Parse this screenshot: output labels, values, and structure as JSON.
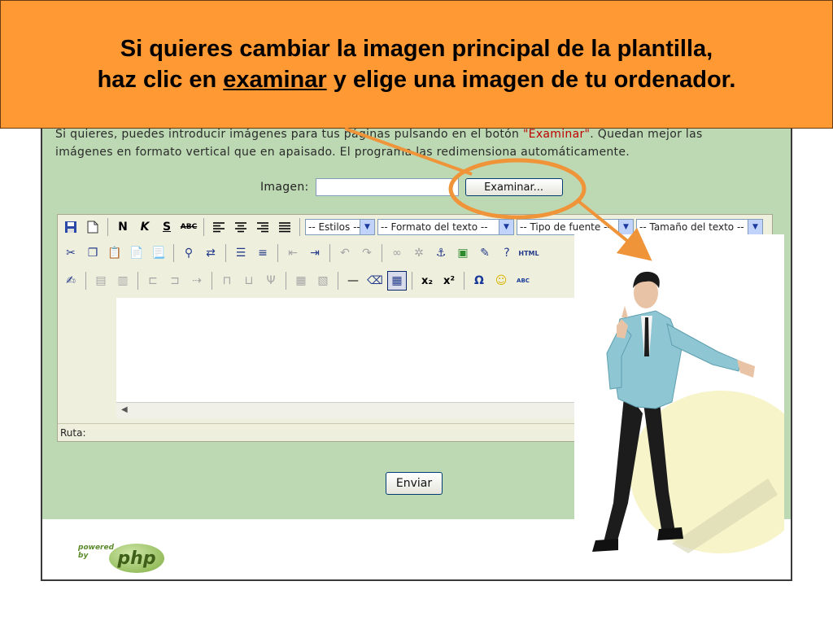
{
  "callout": {
    "line1": "Si quieres cambiar la imagen principal de la plantilla,",
    "line2_pre": "haz clic en ",
    "line2_link": "examinar",
    "line2_post": " y elige una imagen de tu ordenador."
  },
  "intro": {
    "line1_pre": "Si quieres, puedes introducir imágenes para tus páginas pulsando en el botón ",
    "line1_red": "\"Examinar\"",
    "line1_post": ". Quedan mejor las",
    "line2": "imágenes en formato vertical que en apaisado. El programa las redimensiona automáticamente."
  },
  "image_field": {
    "label": "Imagen:",
    "value": "",
    "browse_label": "Examinar..."
  },
  "editor": {
    "toolbar1": {
      "bold": "N",
      "italic": "K",
      "strike": "S",
      "abc": "ABC",
      "styles": "-- Estilos --",
      "format": "-- Formato del texto --",
      "font": "-- Tipo de fuente --",
      "size": "-- Tamaño del texto --"
    },
    "toolbar2": {
      "html": "HTML"
    },
    "toolbar3": {
      "subscript": "x₂",
      "superscript": "x²",
      "omega": "Ω",
      "abc": "ABC"
    },
    "path_label": "Ruta:"
  },
  "submit_label": "Enviar",
  "footer": {
    "powered_line1": "powered",
    "powered_line2": "by",
    "logo_text": "php"
  },
  "colors": {
    "callout_bg": "#ff9933",
    "page_bg": "#bcd9b3",
    "annotation": "#f0943a",
    "link_red": "#c00000"
  },
  "icons": [
    "save-icon",
    "new-document-icon",
    "cut-icon",
    "copy-icon",
    "paste-icon",
    "find-icon",
    "undo-icon",
    "redo-icon",
    "link-icon",
    "anchor-icon",
    "image-icon",
    "help-icon",
    "table-icon",
    "smiley-icon",
    "spellcheck-icon"
  ]
}
